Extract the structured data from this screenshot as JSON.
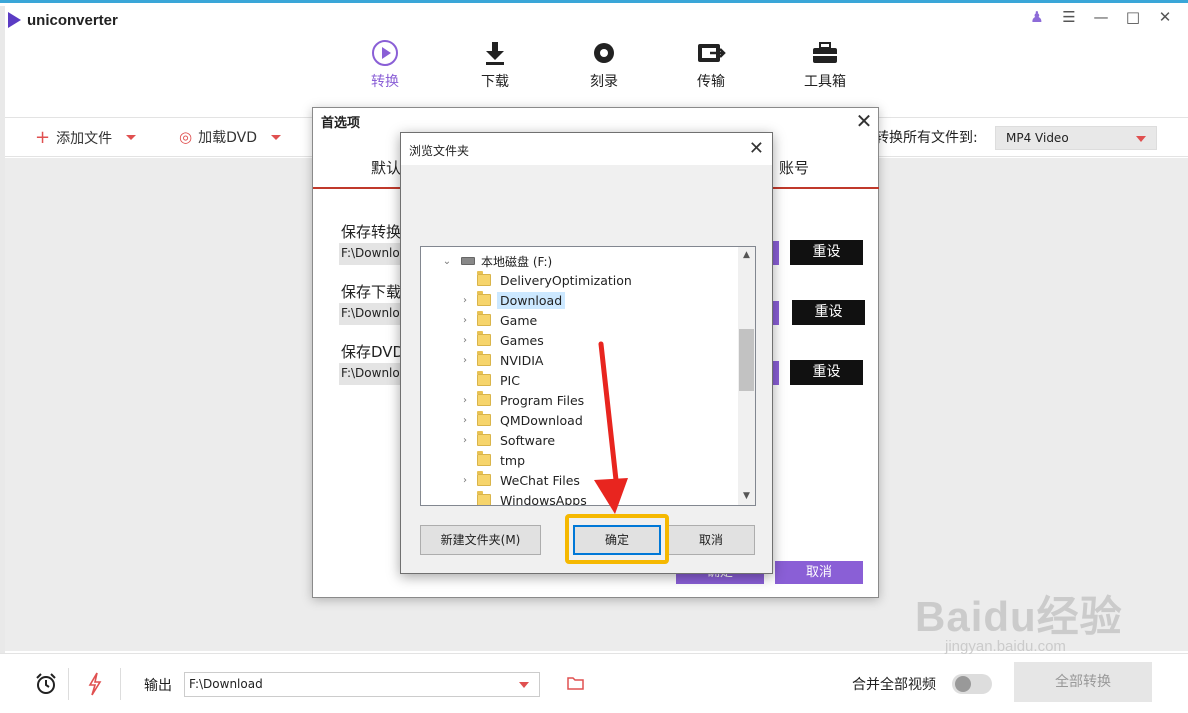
{
  "app": {
    "name": "uniconverter"
  },
  "nav": [
    {
      "label": "转换",
      "icon": "convert-icon"
    },
    {
      "label": "下载",
      "icon": "download-icon"
    },
    {
      "label": "刻录",
      "icon": "burn-icon"
    },
    {
      "label": "传输",
      "icon": "transfer-icon"
    },
    {
      "label": "工具箱",
      "icon": "toolbox-icon"
    }
  ],
  "toolbar": {
    "add_files": "添加文件",
    "load_dvd": "加载DVD",
    "convert_all_to": "转换所有文件到:",
    "format": "MP4 Video"
  },
  "bottom": {
    "output_label": "输出",
    "output_path": "F:\\Download",
    "merge_label": "合并全部视频",
    "convert_all_button": "全部转换"
  },
  "preferences": {
    "title": "首选项",
    "tab_default": "默认",
    "tab_account": "账号",
    "rows": [
      {
        "label": "保存转换",
        "path": "F:\\Downloa",
        "reset": "重设"
      },
      {
        "label": "保存下载",
        "path": "F:\\Downloa",
        "reset": "重设"
      },
      {
        "label": "保存DVD文",
        "path": "F:\\Downloa",
        "reset": "重设"
      }
    ],
    "ok": "确定",
    "cancel": "取消"
  },
  "browse": {
    "title": "浏览文件夹",
    "root": "本地磁盘 (F:)",
    "folders": [
      {
        "name": "DeliveryOptimization",
        "expandable": false
      },
      {
        "name": "Download",
        "expandable": true,
        "selected": true
      },
      {
        "name": "Game",
        "expandable": true
      },
      {
        "name": "Games",
        "expandable": true
      },
      {
        "name": "NVIDIA",
        "expandable": true
      },
      {
        "name": "PIC",
        "expandable": false
      },
      {
        "name": "Program Files",
        "expandable": true
      },
      {
        "name": "QMDownload",
        "expandable": true
      },
      {
        "name": "Software",
        "expandable": true
      },
      {
        "name": "tmp",
        "expandable": false
      },
      {
        "name": "WeChat Files",
        "expandable": true
      },
      {
        "name": "WindowsApps",
        "expandable": false
      }
    ],
    "new_folder": "新建文件夹(M)",
    "ok": "确定",
    "cancel": "取消"
  },
  "watermark": {
    "main": "Baidu经验",
    "sub": "jingyan.baidu.com"
  },
  "colors": {
    "accent": "#8a5fd6",
    "highlight": "#f5b800",
    "arrow": "#e8251f"
  }
}
